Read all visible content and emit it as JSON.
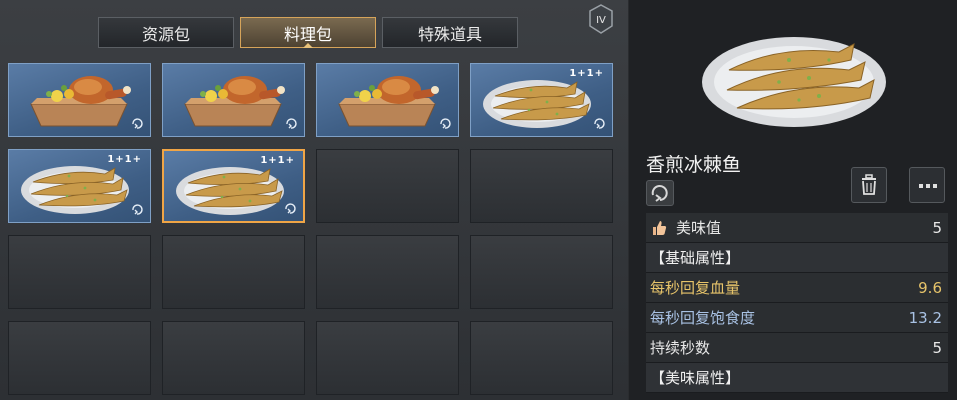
{
  "tabs": [
    {
      "label": "资源包"
    },
    {
      "label": "料理包"
    },
    {
      "label": "特殊道具"
    }
  ],
  "badge": "IV",
  "slots": [
    {
      "item": "chicken-box"
    },
    {
      "item": "chicken-box"
    },
    {
      "item": "chicken-box"
    },
    {
      "item": "fish-plate",
      "tags": "1+1+"
    },
    {
      "item": "fish-plate",
      "tags": "1+1+"
    },
    {
      "item": "fish-plate",
      "tags": "1+1+",
      "selected": true
    },
    {
      "item": "empty"
    },
    {
      "item": "empty"
    },
    {
      "item": "empty"
    },
    {
      "item": "empty"
    },
    {
      "item": "empty"
    },
    {
      "item": "empty"
    },
    {
      "item": "empty"
    },
    {
      "item": "empty"
    },
    {
      "item": "empty"
    },
    {
      "item": "empty"
    }
  ],
  "detail": {
    "name": "香煎冰棘鱼",
    "taste_label": "美味值",
    "taste_value": "5",
    "base_header": "【基础属性】",
    "hp_label": "每秒回复血量",
    "hp_value": "9.6",
    "satiety_label": "每秒回复饱食度",
    "satiety_value": "13.2",
    "duration_label": "持续秒数",
    "duration_value": "5",
    "taste_header": "【美味属性】"
  },
  "colors": {
    "accent": "#f0a546",
    "slot_blue": "#4a6d96",
    "hp_yellow": "#e7c46a",
    "satiety_blue": "#a9c2e4"
  }
}
